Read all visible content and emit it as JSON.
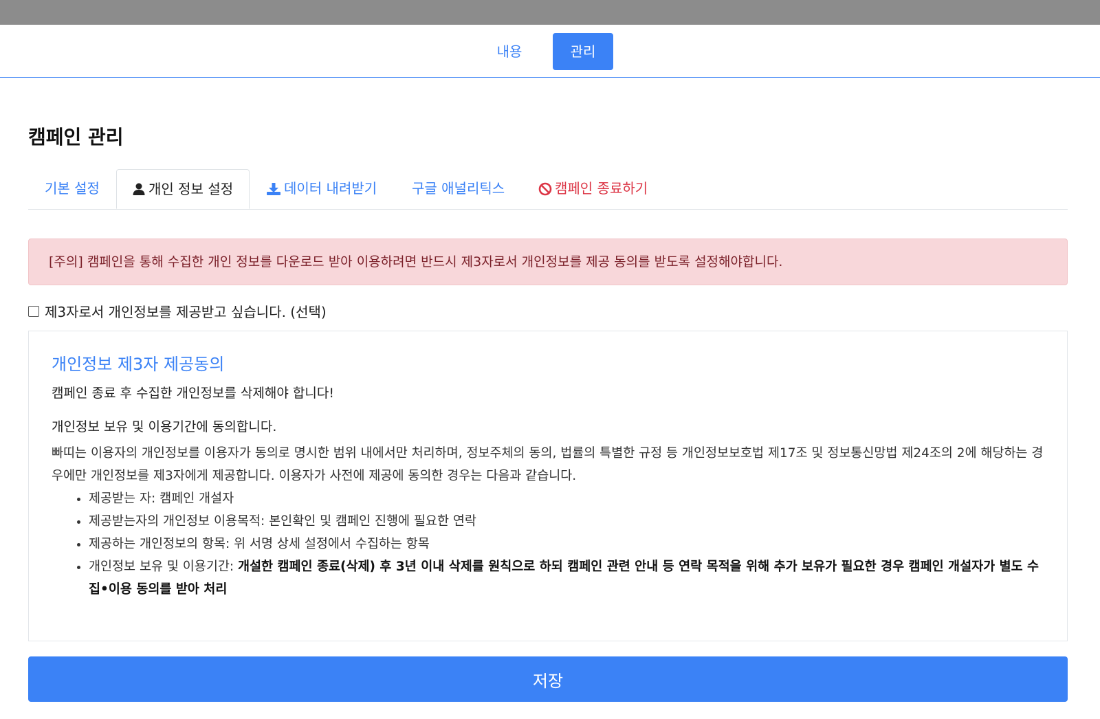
{
  "top_tabs": {
    "content": "내용",
    "manage": "관리"
  },
  "page_title": "캠페인 관리",
  "sub_tabs": {
    "basic": "기본 설정",
    "privacy": "개인 정보 설정",
    "download": "데이터 내려받기",
    "ga": "구글 애널리틱스",
    "end": "캠페인 종료하기"
  },
  "icons": {
    "privacy": "user-icon",
    "download": "download-icon",
    "end": "ban-icon"
  },
  "colors": {
    "accent": "#3b82f6",
    "danger": "#dc3545",
    "alert_bg": "#f8d7da"
  },
  "alert_text": "[주의] 캠페인을 통해 수집한 개인 정보를 다운로드 받아 이용하려면 반드시 제3자로서 개인정보를 제공 동의를 받도록 설정해야합니다.",
  "third_party_checkbox": {
    "label": "제3자로서 개인정보를 제공받고 싶습니다. (선택)",
    "checked": false
  },
  "consent": {
    "title": "개인정보 제3자 제공동의",
    "warning": "캠페인 종료 후 수집한 개인정보를 삭제해야 합니다!",
    "subtitle": "개인정보 보유 및 이용기간에 동의합니다.",
    "body": "빠띠는 이용자의 개인정보를 이용자가 동의로 명시한 범위 내에서만 처리하며, 정보주체의 동의, 법률의 특별한 규정 등 개인정보보호법 제17조 및 정보통신망법 제24조의 2에 해당하는 경우에만 개인정보를 제3자에게 제공합니다. 이용자가 사전에 제공에 동의한 경우는 다음과 같습니다.",
    "items": [
      {
        "label": "제공받는 자: ",
        "value": "캠페인 개설자"
      },
      {
        "label": "제공받는자의 개인정보 이용목적: ",
        "value": "본인확인 및 캠페인 진행에 필요한 연락"
      },
      {
        "label": "제공하는 개인정보의 항목: ",
        "value": "위 서명 상세 설정에서 수집하는 항목"
      }
    ],
    "retention_label": "개인정보 보유 및 이용기간: ",
    "retention_value": "개설한 캠페인 종료(삭제) 후 3년 이내 삭제를 원칙으로 하되 캠페인 관련 안내 등 연락 목적을 위해 추가 보유가 필요한 경우 캠페인 개설자가 별도 수집•이용 동의를 받아 처리"
  },
  "save_button": "저장"
}
